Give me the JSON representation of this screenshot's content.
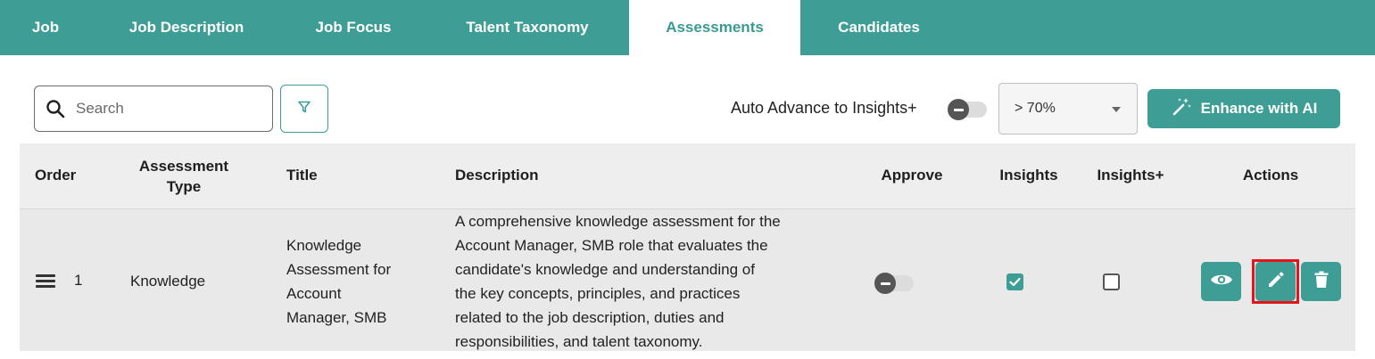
{
  "tabs": [
    {
      "label": "Job",
      "active": false
    },
    {
      "label": "Job Description",
      "active": false
    },
    {
      "label": "Job Focus",
      "active": false
    },
    {
      "label": "Talent Taxonomy",
      "active": false
    },
    {
      "label": "Assessments",
      "active": true
    },
    {
      "label": "Candidates",
      "active": false
    }
  ],
  "toolbar": {
    "search_placeholder": "Search",
    "auto_advance_label": "Auto Advance to Insights+",
    "auto_advance_on": false,
    "threshold_value": "> 70%",
    "enhance_label": "Enhance with AI"
  },
  "table": {
    "headers": {
      "order": "Order",
      "assessment_type_line1": "Assessment",
      "assessment_type_line2": "Type",
      "title": "Title",
      "description": "Description",
      "approve": "Approve",
      "insights": "Insights",
      "insights_plus": "Insights+",
      "actions": "Actions"
    },
    "rows": [
      {
        "order": "1",
        "type": "Knowledge",
        "title_lines": [
          "Knowledge",
          "Assessment for",
          "Account",
          "Manager, SMB"
        ],
        "description_lines": [
          "A comprehensive knowledge assessment for the",
          "Account Manager, SMB role that evaluates the",
          "candidate's knowledge and understanding of",
          "the key concepts, principles, and practices",
          "related to the job description, duties and",
          "responsibilities, and talent taxonomy."
        ],
        "approved": false,
        "insights": true,
        "insights_plus": false
      }
    ]
  },
  "colors": {
    "accent": "#3e9e96",
    "highlight": "#e3141c"
  },
  "icons": [
    "search-icon",
    "filter-icon",
    "magic-wand-icon",
    "chevron-down-icon",
    "drag-handle-icon",
    "eye-icon",
    "pencil-icon",
    "trash-icon",
    "check-icon"
  ]
}
